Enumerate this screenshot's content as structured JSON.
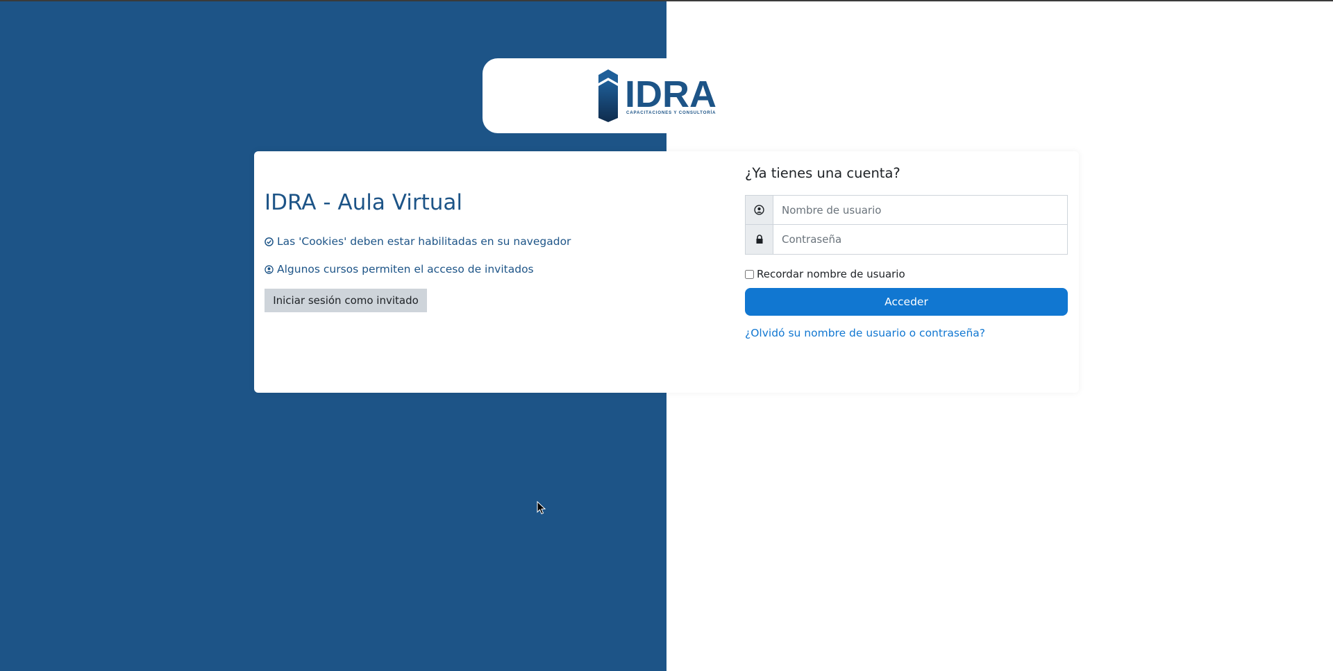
{
  "branding": {
    "logo_text": "IDRA",
    "logo_subtext": "CAPACITACIONES Y CONSULTORÍA",
    "brand_color": "#1d5487"
  },
  "left_panel": {
    "site_title": "IDRA - Aula Virtual",
    "cookies_notice": "Las 'Cookies' deben estar habilitadas en su navegador",
    "guest_notice": "Algunos cursos permiten el acceso de invitados",
    "guest_button_label": "Iniciar sesión como invitado"
  },
  "login": {
    "heading": "¿Ya tienes una cuenta?",
    "username_placeholder": "Nombre de usuario",
    "username_value": "",
    "password_placeholder": "Contraseña",
    "password_value": "",
    "remember_label": "Recordar nombre de usuario",
    "remember_checked": false,
    "submit_label": "Acceder",
    "forgot_link": "¿Olvidó su nombre de usuario o contraseña?",
    "accent_color": "#1177d1"
  }
}
